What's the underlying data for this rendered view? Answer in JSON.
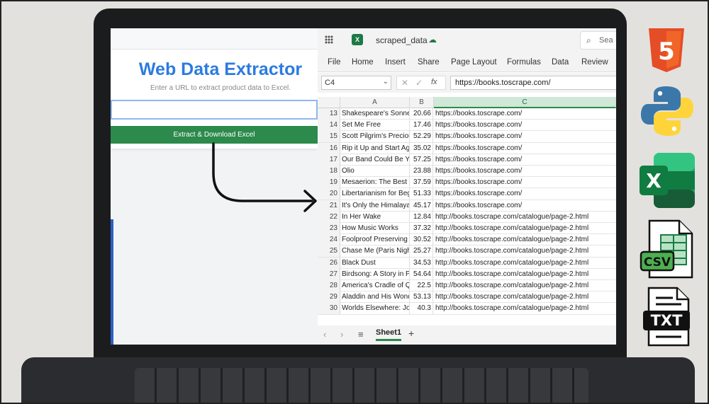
{
  "webapp": {
    "title": "Web Data Extractor",
    "subtitle": "Enter a URL to extract product data to Excel.",
    "url_value": "",
    "button_label": "Extract & Download Excel"
  },
  "excel": {
    "app_badge": "X",
    "filename": "scraped_data",
    "search_text": "Sea",
    "menu": [
      "File",
      "Home",
      "Insert",
      "Share",
      "Page Layout",
      "Formulas",
      "Data",
      "Review"
    ],
    "name_box": "C4",
    "fx_label": "fx",
    "formula_value": "https://books.toscrape.com/",
    "columns": [
      "A",
      "B",
      "C"
    ],
    "selected_column": "C",
    "rows": [
      {
        "n": "13",
        "a": "Shakespeare's Sonnets",
        "b": "20.66",
        "c": "https://books.toscrape.com/"
      },
      {
        "n": "14",
        "a": "Set Me Free",
        "b": "17.46",
        "c": "https://books.toscrape.com/"
      },
      {
        "n": "15",
        "a": "Scott Pilgrim's Precious Little Life",
        "b": "52.29",
        "c": "https://books.toscrape.com/"
      },
      {
        "n": "16",
        "a": "Rip it Up and Start Again",
        "b": "35.02",
        "c": "https://books.toscrape.com/"
      },
      {
        "n": "17",
        "a": "Our Band Could Be Your Life",
        "b": "57.25",
        "c": "https://books.toscrape.com/"
      },
      {
        "n": "18",
        "a": "Olio",
        "b": "23.88",
        "c": "https://books.toscrape.com/"
      },
      {
        "n": "19",
        "a": "Mesaerion: The Best Science Fiction",
        "b": "37.59",
        "c": "https://books.toscrape.com/"
      },
      {
        "n": "20",
        "a": "Libertarianism for Beginners",
        "b": "51.33",
        "c": "https://books.toscrape.com/"
      },
      {
        "n": "21",
        "a": "It's Only the Himalayas",
        "b": "45.17",
        "c": "https://books.toscrape.com/"
      },
      {
        "n": "22",
        "a": "In Her Wake",
        "b": "12.84",
        "c": "http://books.toscrape.com/catalogue/page-2.html"
      },
      {
        "n": "23",
        "a": "How Music Works",
        "b": "37.32",
        "c": "http://books.toscrape.com/catalogue/page-2.html"
      },
      {
        "n": "24",
        "a": "Foolproof Preserving",
        "b": "30.52",
        "c": "http://books.toscrape.com/catalogue/page-2.html"
      },
      {
        "n": "25",
        "a": "Chase Me (Paris Nights)",
        "b": "25.27",
        "c": "http://books.toscrape.com/catalogue/page-2.html"
      },
      {
        "n": "26",
        "a": "Black Dust",
        "b": "34.53",
        "c": "http://books.toscrape.com/catalogue/page-2.html"
      },
      {
        "n": "27",
        "a": "Birdsong: A Story in Pictures",
        "b": "54.64",
        "c": "http://books.toscrape.com/catalogue/page-2.html"
      },
      {
        "n": "28",
        "a": "America's Cradle of Quarterbacks",
        "b": "22.5",
        "c": "http://books.toscrape.com/catalogue/page-2.html"
      },
      {
        "n": "29",
        "a": "Aladdin and His Wonderful Lamp",
        "b": "53.13",
        "c": "http://books.toscrape.com/catalogue/page-2.html"
      },
      {
        "n": "30",
        "a": "Worlds Elsewhere: Journeys",
        "b": "40.3",
        "c": "http://books.toscrape.com/catalogue/page-2.html"
      }
    ],
    "sheet_tab": "Sheet1"
  },
  "side_icons": [
    {
      "name": "html5-icon",
      "label": "5"
    },
    {
      "name": "python-icon",
      "label": ""
    },
    {
      "name": "excel-icon",
      "label": "X"
    },
    {
      "name": "csv-icon",
      "label": "CSV"
    },
    {
      "name": "txt-icon",
      "label": "TXT"
    }
  ],
  "colors": {
    "title_blue": "#2c7be0",
    "button_green": "#2c8a4c",
    "excel_green": "#1d7a45",
    "html5_orange": "#e44d26",
    "python_blue": "#3b77a8",
    "python_yellow": "#ffd43b"
  }
}
